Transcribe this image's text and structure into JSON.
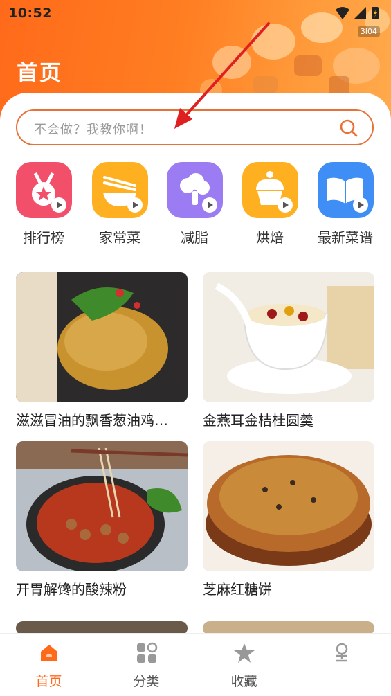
{
  "status": {
    "time": "10:52",
    "network": "3I04"
  },
  "header": {
    "title": "首页"
  },
  "search": {
    "placeholder": "不会做？我教你啊！"
  },
  "categories": [
    {
      "label": "排行榜",
      "icon": "ranking-medal-icon",
      "color": "#f2506a"
    },
    {
      "label": "家常菜",
      "icon": "noodle-bowl-icon",
      "color": "#ffb020"
    },
    {
      "label": "减脂",
      "icon": "broccoli-icon",
      "color": "#9b7cf2"
    },
    {
      "label": "烘焙",
      "icon": "cupcake-icon",
      "color": "#ffb020"
    },
    {
      "label": "最新菜谱",
      "icon": "open-book-icon",
      "color": "#3f8ef5"
    }
  ],
  "recipes": [
    {
      "title": "滋滋冒油的飘香葱油鸡…"
    },
    {
      "title": "金燕耳金桔桂圆羹"
    },
    {
      "title": "开胃解馋的酸辣粉"
    },
    {
      "title": "芝麻红糖饼"
    }
  ],
  "tabs": [
    {
      "label": "首页",
      "icon": "home-icon",
      "active": true
    },
    {
      "label": "分类",
      "icon": "grid-icon",
      "active": false
    },
    {
      "label": "收藏",
      "icon": "star-icon",
      "active": false
    },
    {
      "label": "",
      "icon": "profile-icon",
      "active": false
    }
  ],
  "colors": {
    "accent": "#ff6a1a",
    "search_border": "#e8713a"
  }
}
